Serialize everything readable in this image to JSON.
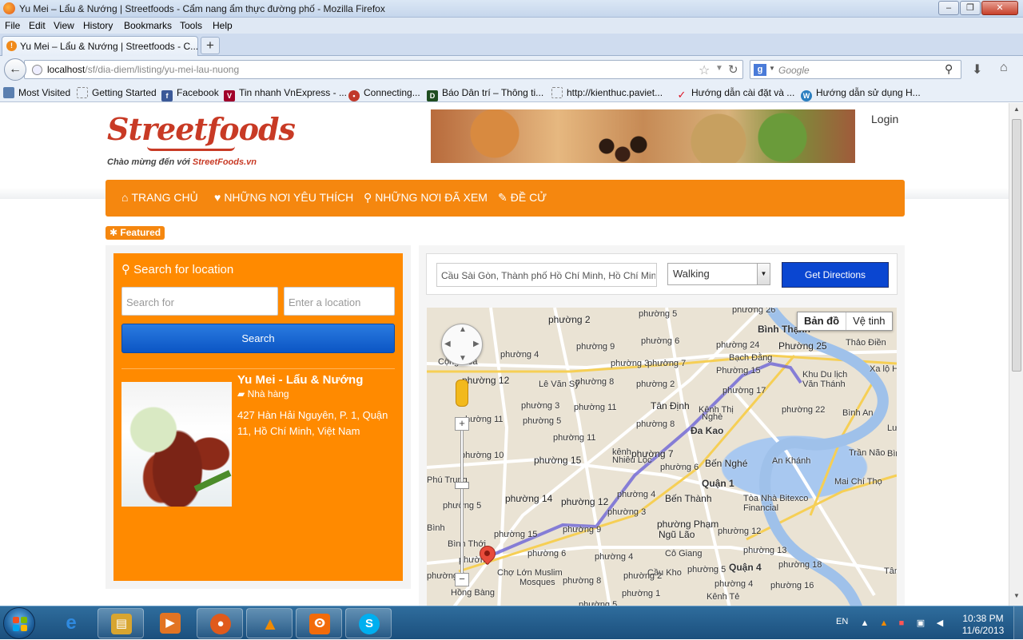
{
  "window": {
    "title": "Yu Mei – Lẩu & Nướng | Streetfoods - Cẩm nang ẩm thực đường phố - Mozilla Firefox",
    "min": "–",
    "max": "❐",
    "close": "✕"
  },
  "menu": [
    "File",
    "Edit",
    "View",
    "History",
    "Bookmarks",
    "Tools",
    "Help"
  ],
  "tab": {
    "label": "Yu Mei – Lẩu & Nướng | Streetfoods - C...",
    "new_tab": "+"
  },
  "address": {
    "host": "localhost",
    "path": "/sf/dia-diem/listing/yu-mei-lau-nuong"
  },
  "search_engine": {
    "placeholder": "Google"
  },
  "bookmarks": [
    {
      "label": "Most Visited",
      "icon": "page-icon",
      "color": "#5a7fb0"
    },
    {
      "label": "Getting Started",
      "icon": "dashed-page-icon",
      "color": "#ffffff"
    },
    {
      "label": "Facebook",
      "icon": "facebook-icon",
      "color": "#3b5998"
    },
    {
      "label": "Tin nhanh VnExpress - ...",
      "icon": "vnexpress-icon",
      "color": "#a0002a"
    },
    {
      "label": "Connecting...",
      "icon": "loading-icon",
      "color": "#c0392b"
    },
    {
      "label": "Báo Dân trí – Thông ti...",
      "icon": "dantri-icon",
      "color": "#1f4d20"
    },
    {
      "label": "http://kienthuc.paviet...",
      "icon": "dashed-page-icon",
      "color": "#ffffff"
    },
    {
      "label": "Hướng dẫn cài đặt và ...",
      "icon": "check-icon",
      "color": "#d12"
    },
    {
      "label": "Hướng dẫn sử dụng H...",
      "icon": "wordpress-icon",
      "color": "#2b7fc0"
    }
  ],
  "site": {
    "logo_text": "Streetfoods",
    "tagline_prefix": "Chào mừng đến với ",
    "tagline_site": "StreetFoods.vn",
    "login": "Login",
    "nav": [
      {
        "label": "TRANG CHỦ",
        "icon": "home-icon",
        "glyph": "⌂"
      },
      {
        "label": "NHỮNG NƠI YÊU THÍCH",
        "icon": "heart-icon",
        "glyph": "♥"
      },
      {
        "label": "NHỮNG NƠI ĐÃ XEM",
        "icon": "map-pin-icon",
        "glyph": "⚲"
      },
      {
        "label": "ĐỀ CỬ",
        "icon": "pencil-icon",
        "glyph": "✎"
      }
    ],
    "featured_label": "Featured",
    "accent": "#f5870f"
  },
  "search_panel": {
    "heading": "Search for location",
    "search_placeholder": "Search for",
    "location_placeholder": "Enter a location",
    "button": "Search"
  },
  "listing": {
    "title": "Yu Mei - Lẩu & Nướng",
    "category": "Nhà hàng",
    "address": "427 Hàn Hải Nguyên, P. 1, Quận 11, Hồ Chí Minh, Việt Nam"
  },
  "directions": {
    "from_value": "Cầu Sài Gòn, Thành phố Hồ Chí Minh, Hồ Chí Minh",
    "mode": "Walking",
    "button": "Get Directions"
  },
  "map": {
    "type_buttons": [
      "Bản đồ",
      "Vệ tinh"
    ],
    "zoom_in": "+",
    "zoom_out": "−",
    "labels": [
      "phường 26",
      "Bình Thạnh",
      "Phường 25",
      "Thảo Điền",
      "phường 2",
      "phường 5",
      "phường 9",
      "phường 4",
      "phường 6",
      "phường 24",
      "Bạch Đằng",
      "Phường 15",
      "Khu Du lịch",
      "Văn Thánh",
      "Xa lộ Hà",
      "Cộng Hòa",
      "phường 12",
      "phường 3",
      "phường 7",
      "phường 17",
      "phường 8",
      "Lê Văn Sỹ",
      "phường 2",
      "Tân Định",
      "phường 22",
      "Bình An",
      "phường 11",
      "phường 5",
      "phường 11",
      "phường 8",
      "Đa Kao",
      "phường 15",
      "phường 10",
      "phường 15",
      "phường 7",
      "Bến Nghé",
      "An Khánh",
      "Phú Trung",
      "phường 6",
      "Quận 1",
      "phường 5",
      "phường 14",
      "phường 12",
      "phường 4",
      "Bến Thành",
      "Tòa Nhà Bitexco",
      "Financial",
      "Mai Chí Thọ",
      "phường 3",
      "phường Phạm",
      "Ngũ Lão",
      "phường 15",
      "phường 9",
      "phường 12",
      "phường 6",
      "Cô Giang",
      "phường 13",
      "Chợ Lớn Muslim",
      "phường 4",
      "Cầu Kho",
      "phường 5",
      "Quận 4",
      "phường 18",
      "Mosques",
      "phường 8",
      "phường 2",
      "phường 4",
      "phường 16",
      "Hồng Bàng",
      "phường 1",
      "Kênh Tẻ",
      "phường 5",
      "Trần Não",
      "Bình Khánh",
      "Lương",
      "Tân Th",
      "Bình Thới",
      "phường",
      "kênh",
      "Nhiêu Lộc",
      "Kênh Thị",
      "Nghè"
    ]
  },
  "taskbar": {
    "apps": [
      {
        "name": "internet-explorer-icon",
        "glyph": "e",
        "color": "#1e78d0"
      },
      {
        "name": "explorer-icon",
        "glyph": "▤",
        "color": "#d8a530"
      },
      {
        "name": "media-player-icon",
        "glyph": "▶",
        "color": "#e27423"
      },
      {
        "name": "firefox-icon",
        "glyph": "●",
        "color": "#e05a1c"
      },
      {
        "name": "vlc-icon",
        "glyph": "▲",
        "color": "#f08a00"
      },
      {
        "name": "xampp-icon",
        "glyph": "ⵙ",
        "color": "#f26b0b"
      },
      {
        "name": "skype-icon",
        "glyph": "S",
        "color": "#00aff0"
      }
    ],
    "lang": "EN",
    "time": "10:38 PM",
    "date": "11/6/2013"
  }
}
